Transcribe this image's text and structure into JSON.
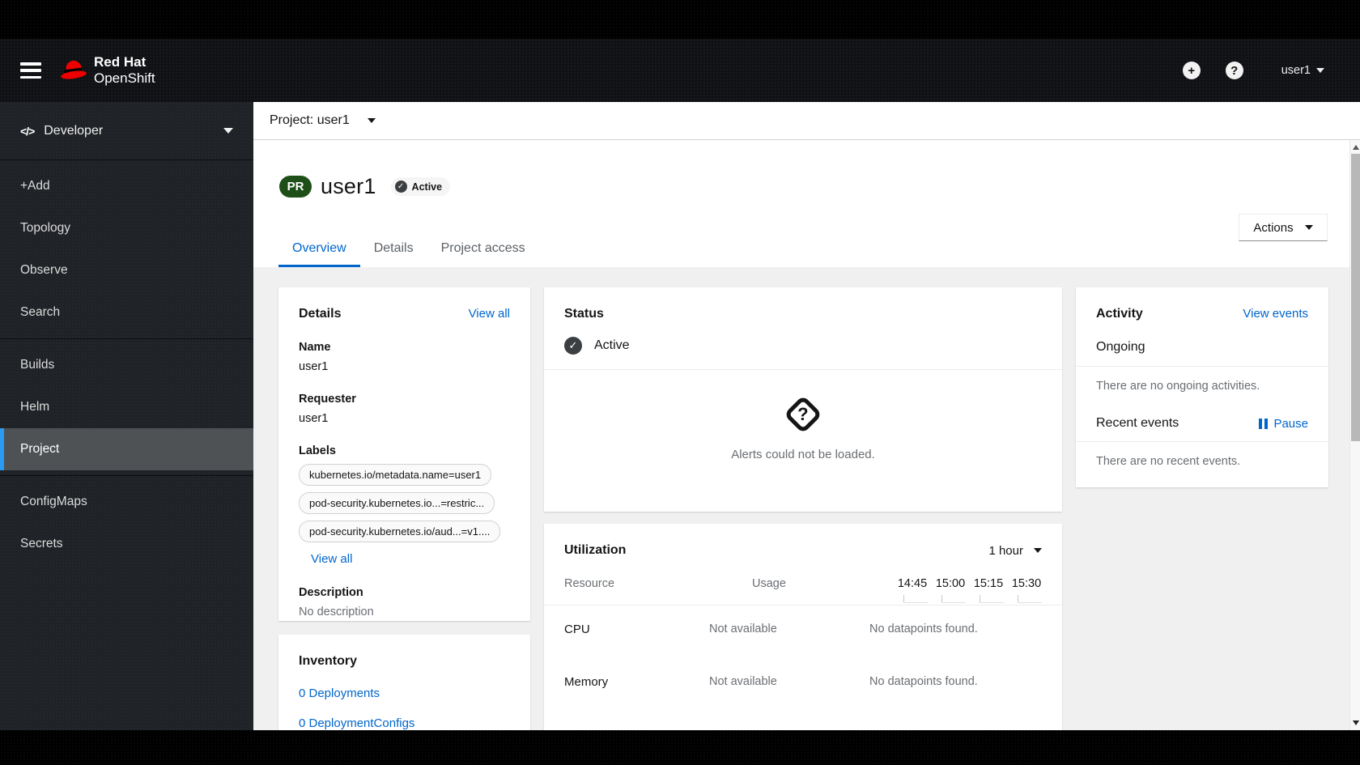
{
  "masthead": {
    "brand_line1": "Red Hat",
    "brand_line2": "OpenShift",
    "plus_icon": "+",
    "help_icon": "?",
    "user_menu_label": "user1"
  },
  "sidebar": {
    "perspective_icon": "</>",
    "perspective": "Developer",
    "groups": [
      {
        "items": [
          {
            "label": "+Add"
          },
          {
            "label": "Topology"
          },
          {
            "label": "Observe"
          },
          {
            "label": "Search"
          }
        ]
      },
      {
        "items": [
          {
            "label": "Builds"
          },
          {
            "label": "Helm"
          },
          {
            "label": "Project",
            "selected": true
          }
        ]
      },
      {
        "items": [
          {
            "label": "ConfigMaps"
          },
          {
            "label": "Secrets"
          }
        ]
      }
    ]
  },
  "breadcrumb": {
    "label": "Project: user1"
  },
  "page": {
    "resource_badge": "PR",
    "title": "user1",
    "status_badge": "Active",
    "check_glyph": "✓",
    "actions_label": "Actions"
  },
  "tabs": [
    {
      "label": "Overview",
      "active": true
    },
    {
      "label": "Details",
      "active": false
    },
    {
      "label": "Project access",
      "active": false
    }
  ],
  "details_card": {
    "title": "Details",
    "view_all": "View all",
    "fields": [
      {
        "label": "Name",
        "value": "user1"
      },
      {
        "label": "Requester",
        "value": "user1"
      }
    ],
    "labels_label": "Labels",
    "labels": [
      "kubernetes.io/metadata.name=user1",
      "pod-security.kubernetes.io...=restric...",
      "pod-security.kubernetes.io/aud...=v1...."
    ],
    "labels_view_all": "View all",
    "description_label": "Description",
    "description_value": "No description"
  },
  "status_card": {
    "title": "Status",
    "status": "Active",
    "check_glyph": "✓",
    "unknown_glyph": "?",
    "alerts_message": "Alerts could not be loaded."
  },
  "utilization_card": {
    "title": "Utilization",
    "duration": "1 hour",
    "resource_col": "Resource",
    "usage_col": "Usage",
    "times": [
      "14:45",
      "15:00",
      "15:15",
      "15:30"
    ],
    "rows": [
      {
        "name": "CPU",
        "usage": "Not available",
        "datapoints": "No datapoints found."
      },
      {
        "name": "Memory",
        "usage": "Not available",
        "datapoints": "No datapoints found."
      }
    ]
  },
  "activity_card": {
    "title": "Activity",
    "view_events": "View events",
    "ongoing_label": "Ongoing",
    "ongoing_empty": "There are no ongoing activities.",
    "recent_label": "Recent events",
    "pause_label": "Pause",
    "recent_empty": "There are no recent events."
  },
  "inventory_card": {
    "title": "Inventory",
    "items": [
      "0 Deployments",
      "0 DeploymentConfigs"
    ]
  },
  "colors": {
    "link": "#0066cc",
    "nav_selected_border": "#2b9af3",
    "project_badge_bg": "#1e4f18",
    "body_bg": "#f0f0f0"
  }
}
